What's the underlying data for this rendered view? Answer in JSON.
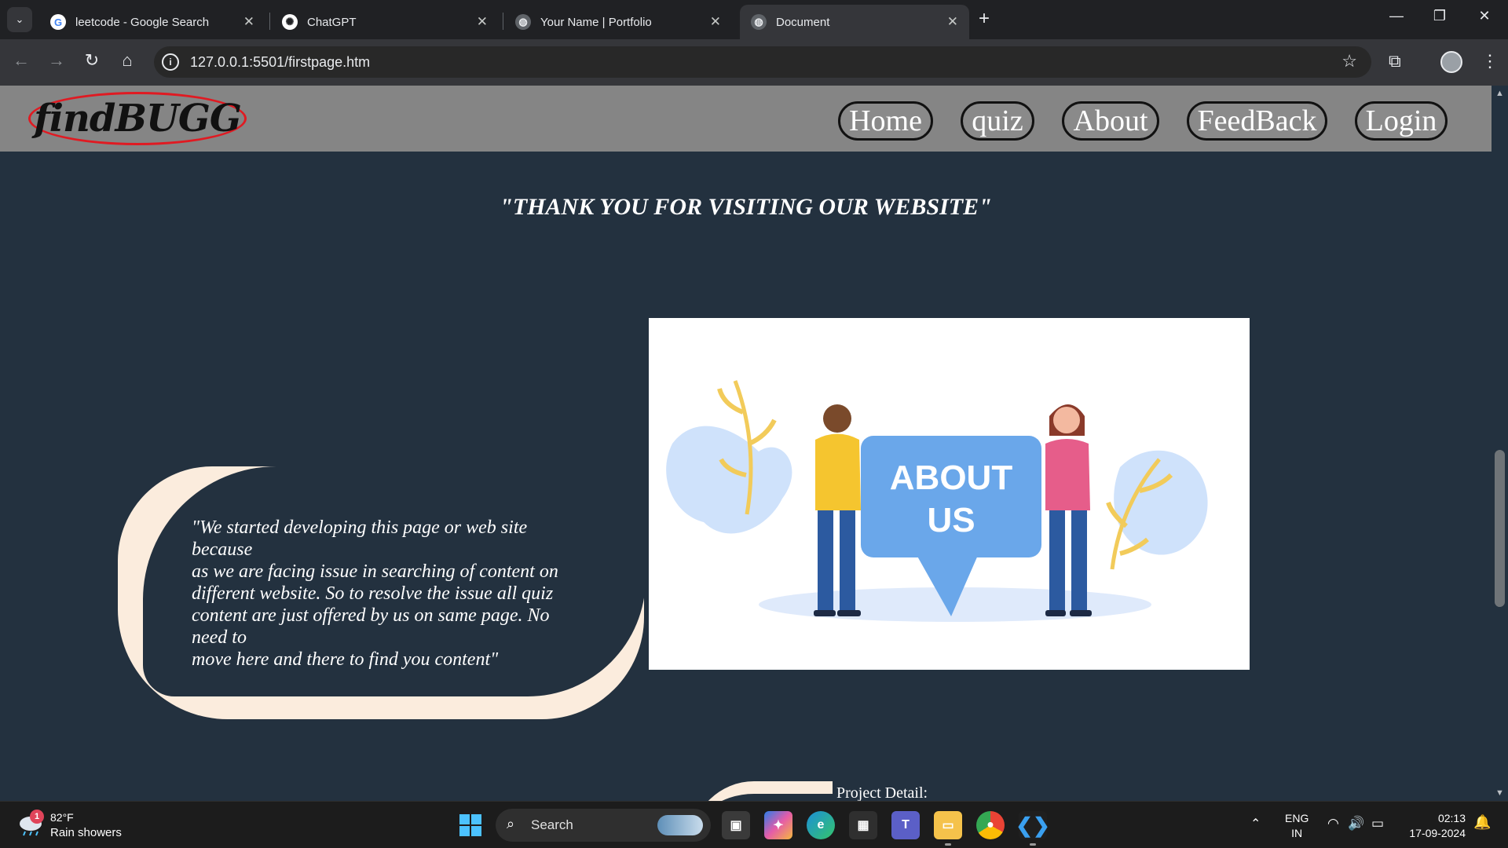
{
  "browser": {
    "tabs": [
      {
        "title": "leetcode - Google Search",
        "icon": "google-icon",
        "active": false
      },
      {
        "title": "ChatGPT",
        "icon": "chatgpt-icon",
        "active": false
      },
      {
        "title": "Your Name | Portfolio",
        "icon": "globe-icon",
        "active": false
      },
      {
        "title": "Document",
        "icon": "globe-icon",
        "active": true
      }
    ],
    "url": "127.0.0.1:5501/firstpage.htm"
  },
  "site": {
    "logo": "findBUGG",
    "nav": [
      "Home",
      "quiz",
      "About",
      "FeedBack",
      "Login"
    ],
    "heading": "\"THANK YOU FOR VISITING OUR WEBSITE\"",
    "quote_lines": [
      "\"We started developing this page or web site",
      "because",
      "as we are facing issue in searching of content on",
      "different website. So to resolve the issue all quiz",
      "content are just offered by us on same page. No",
      "need to",
      "move here and there to find you content\""
    ],
    "about_image_text": [
      "ABOUT",
      "US"
    ],
    "project_detail": "Project Detail:"
  },
  "taskbar": {
    "weather": {
      "badge": "1",
      "temp": "82°F",
      "desc": "Rain showers"
    },
    "search_label": "Search",
    "lang": [
      "ENG",
      "IN"
    ],
    "time": "02:13",
    "date": "17-09-2024"
  },
  "colors": {
    "page_bg": "#23313f",
    "nav_bg": "#858585",
    "quote_shape": "#fbecdd",
    "logo_ring": "#e01a22"
  }
}
